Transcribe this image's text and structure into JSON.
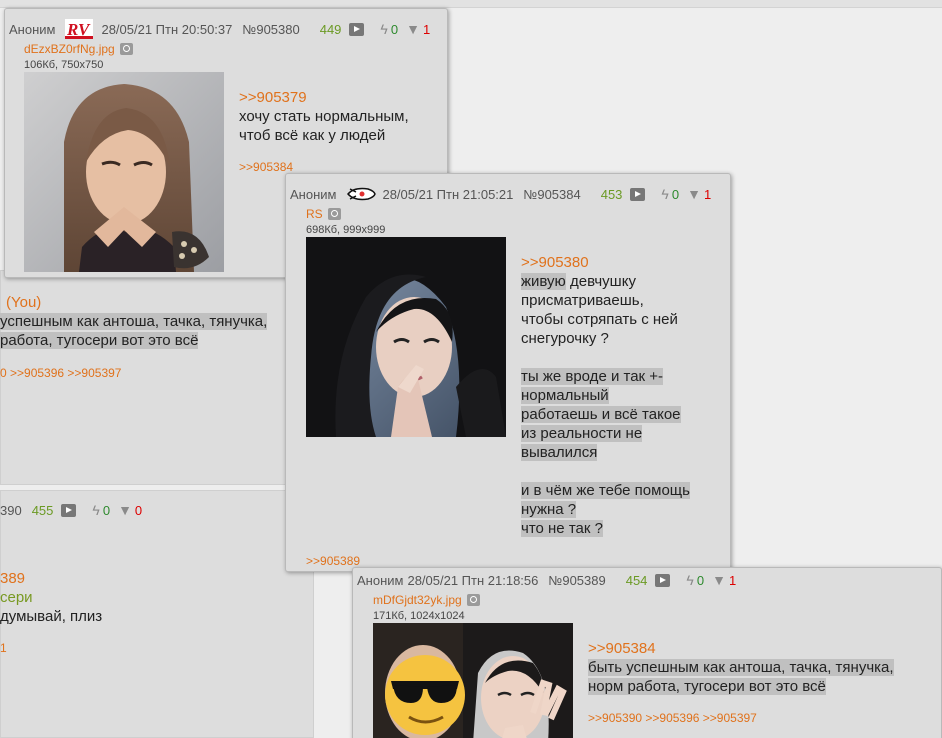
{
  "background_posts": {
    "post1": {
      "you_label": "(You)",
      "line1": "успешным как антоша, тачка, тянучка,",
      "line2": "работа, тугосери вот это всё",
      "links": "0 >>905396 >>905397"
    },
    "post2": {
      "num_fragment": "390",
      "count": "455",
      "likes": "0",
      "dislikes": "0",
      "reply_fragment": "389",
      "quote_fragment": "сери",
      "text_fragment": "думывай, плиз",
      "link_fragment": "1"
    }
  },
  "post_905380": {
    "author": "Аноним",
    "datetime": "28/05/21 Птн 20:50:37",
    "number": "№905380",
    "count": "449",
    "likes": "0",
    "dislikes": "1",
    "file_name": "dEzxBZ0rfNg.jpg",
    "file_meta": "106Кб, 750x750",
    "reply_to": ">>905379",
    "text": [
      "хочу стать нормальным,",
      "чтоб всё как у людей"
    ],
    "replies": ">>905384",
    "icon": "rv-logo-icon",
    "image_desc": "girl-photo"
  },
  "post_905384": {
    "author": "Аноним",
    "datetime": "28/05/21 Птн 21:05:21",
    "number": "№905384",
    "count": "453",
    "likes": "0",
    "dislikes": "1",
    "file_name": "RS",
    "file_meta": "698Кб, 999x999",
    "reply_to": ">>905380",
    "text": [
      "живую",
      " девчушку",
      "присматриваешь,",
      "чтобы сотряпать с ней",
      "снегурочку ?",
      "ты же вроде и так +-",
      "нормальный",
      "работаешь и всё такое",
      "из реальности не",
      "вывалился",
      "и в чём же тебе помощь",
      "нужна ?",
      "что не так ?"
    ],
    "replies": ">>905389",
    "icon": "rocket-icon"
  },
  "post_905389": {
    "author": "Аноним",
    "datetime": "28/05/21 Птн 21:18:56",
    "number": "№905389",
    "count": "454",
    "likes": "0",
    "dislikes": "1",
    "file_name": "mDfGjdt32yk.jpg",
    "file_meta": "171Кб, 1024x1024",
    "reply_to": ">>905384",
    "text": [
      "быть успешным как антоша, тачка, тянучка,",
      "норм работа, тугосери вот это всё"
    ],
    "replies": ">>905390 >>905396 >>905397"
  },
  "colors": {
    "link": "#e0721c",
    "count": "#6b9a24",
    "likes": "#2e8a2e",
    "dislikes": "#dd0000",
    "highlight": "#c0c0c0"
  }
}
